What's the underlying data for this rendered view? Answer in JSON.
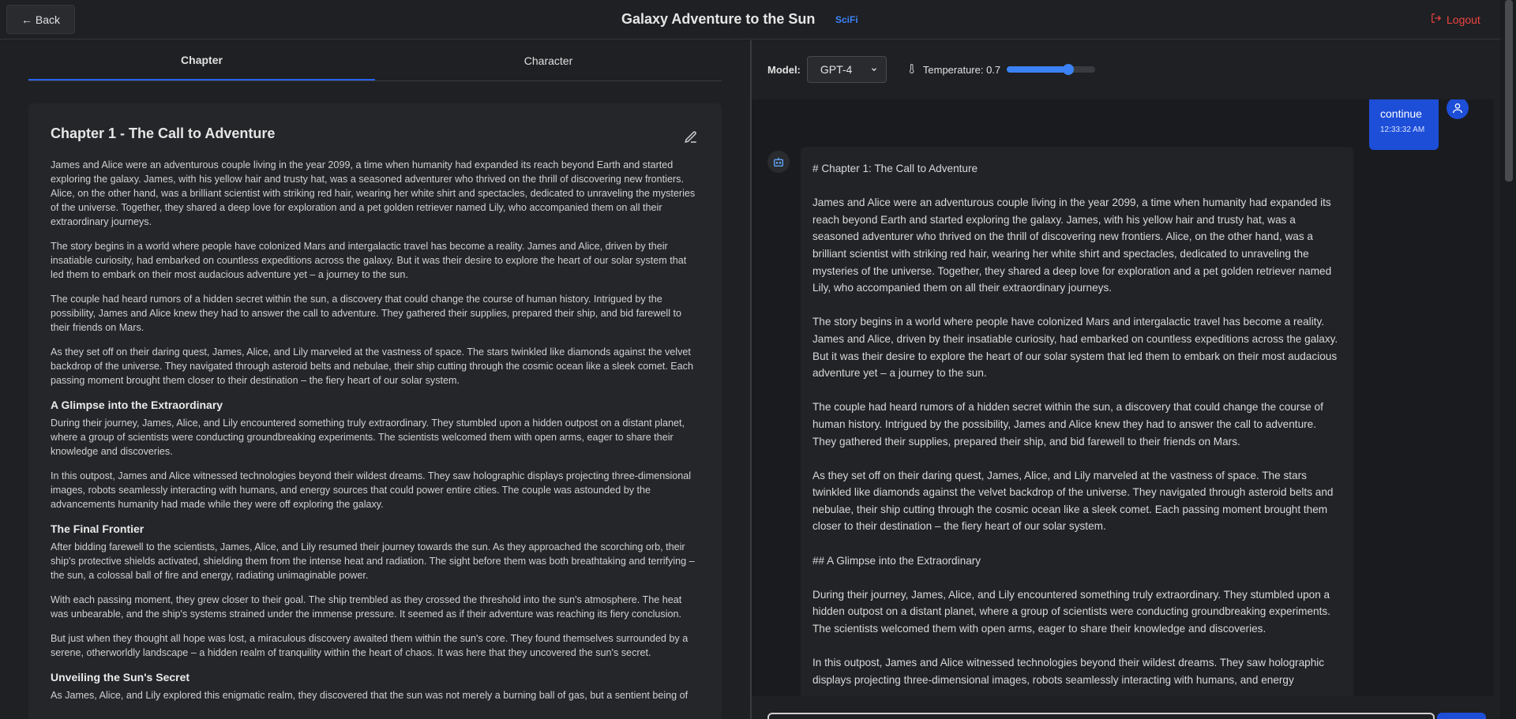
{
  "header": {
    "back_label": "← Back",
    "title": "Galaxy Adventure to the Sun",
    "genre": "SciFi",
    "logout_label": "Logout"
  },
  "left": {
    "tabs": [
      {
        "label": "Chapter",
        "active": true
      },
      {
        "label": "Character",
        "active": false
      }
    ],
    "chapter_title": "Chapter 1 - The Call to Adventure",
    "paragraphs": [
      "James and Alice were an adventurous couple living in the year 2099, a time when humanity had expanded its reach beyond Earth and started exploring the galaxy. James, with his yellow hair and trusty hat, was a seasoned adventurer who thrived on the thrill of discovering new frontiers. Alice, on the other hand, was a brilliant scientist with striking red hair, wearing her white shirt and spectacles, dedicated to unraveling the mysteries of the universe. Together, they shared a deep love for exploration and a pet golden retriever named Lily, who accompanied them on all their extraordinary journeys.",
      "The story begins in a world where people have colonized Mars and intergalactic travel has become a reality. James and Alice, driven by their insatiable curiosity, had embarked on countless expeditions across the galaxy. But it was their desire to explore the heart of our solar system that led them to embark on their most audacious adventure yet – a journey to the sun.",
      "The couple had heard rumors of a hidden secret within the sun, a discovery that could change the course of human history. Intrigued by the possibility, James and Alice knew they had to answer the call to adventure. They gathered their supplies, prepared their ship, and bid farewell to their friends on Mars.",
      "As they set off on their daring quest, James, Alice, and Lily marveled at the vastness of space. The stars twinkled like diamonds against the velvet backdrop of the universe. They navigated through asteroid belts and nebulae, their ship cutting through the cosmic ocean like a sleek comet. Each passing moment brought them closer to their destination – the fiery heart of our solar system."
    ],
    "heading_1": "A Glimpse into the Extraordinary",
    "paragraphs_2": [
      "During their journey, James, Alice, and Lily encountered something truly extraordinary. They stumbled upon a hidden outpost on a distant planet, where a group of scientists were conducting groundbreaking experiments. The scientists welcomed them with open arms, eager to share their knowledge and discoveries.",
      "In this outpost, James and Alice witnessed technologies beyond their wildest dreams. They saw holographic displays projecting three-dimensional images, robots seamlessly interacting with humans, and energy sources that could power entire cities. The couple was astounded by the advancements humanity had made while they were off exploring the galaxy."
    ],
    "heading_2": "The Final Frontier",
    "paragraphs_3": [
      "After bidding farewell to the scientists, James, Alice, and Lily resumed their journey towards the sun. As they approached the scorching orb, their ship's protective shields activated, shielding them from the intense heat and radiation. The sight before them was both breathtaking and terrifying – the sun, a colossal ball of fire and energy, radiating unimaginable power.",
      "With each passing moment, they grew closer to their goal. The ship trembled as they crossed the threshold into the sun's atmosphere. The heat was unbearable, and the ship's systems strained under the immense pressure. It seemed as if their adventure was reaching its fiery conclusion.",
      "But just when they thought all hope was lost, a miraculous discovery awaited them within the sun's core. They found themselves surrounded by a serene, otherworldly landscape – a hidden realm of tranquility within the heart of chaos. It was here that they uncovered the sun's secret."
    ],
    "heading_3": "Unveiling the Sun's Secret",
    "paragraph_4": "As James, Alice, and Lily explored this enigmatic realm, they discovered that the sun was not merely a burning ball of gas, but a sentient being of"
  },
  "right": {
    "model_label": "Model:",
    "model_value": "GPT-4",
    "temperature_label": "Temperature: 0.7",
    "temperature_value": 0.7,
    "user_message": "continue",
    "user_time": "12:33:32 AM",
    "bot_lines": [
      "# Chapter 1: The Call to Adventure",
      "James and Alice were an adventurous couple living in the year 2099, a time when humanity had expanded its reach beyond Earth and started exploring the galaxy. James, with his yellow hair and trusty hat, was a seasoned adventurer who thrived on the thrill of discovering new frontiers. Alice, on the other hand, was a brilliant scientist with striking red hair, wearing her white shirt and spectacles, dedicated to unraveling the mysteries of the universe. Together, they shared a deep love for exploration and a pet golden retriever named Lily, who accompanied them on all their extraordinary journeys.",
      "The story begins in a world where people have colonized Mars and intergalactic travel has become a reality. James and Alice, driven by their insatiable curiosity, had embarked on countless expeditions across the galaxy. But it was their desire to explore the heart of our solar system that led them to embark on their most audacious adventure yet – a journey to the sun.",
      "The couple had heard rumors of a hidden secret within the sun, a discovery that could change the course of human history. Intrigued by the possibility, James and Alice knew they had to answer the call to adventure. They gathered their supplies, prepared their ship, and bid farewell to their friends on Mars.",
      "As they set off on their daring quest, James, Alice, and Lily marveled at the vastness of space. The stars twinkled like diamonds against the velvet backdrop of the universe. They navigated through asteroid belts and nebulae, their ship cutting through the cosmic ocean like a sleek comet. Each passing moment brought them closer to their destination – the fiery heart of our solar system.",
      "## A Glimpse into the Extraordinary",
      "During their journey, James, Alice, and Lily encountered something truly extraordinary. They stumbled upon a hidden outpost on a distant planet, where a group of scientists were conducting groundbreaking experiments. The scientists welcomed them with open arms, eager to share their knowledge and discoveries.",
      "In this outpost, James and Alice witnessed technologies beyond their wildest dreams. They saw holographic displays projecting three-dimensional images, robots seamlessly interacting with humans, and energy"
    ]
  },
  "colors": {
    "accent": "#2563eb",
    "logout": "#ef4444",
    "background": "#1e1f22"
  }
}
